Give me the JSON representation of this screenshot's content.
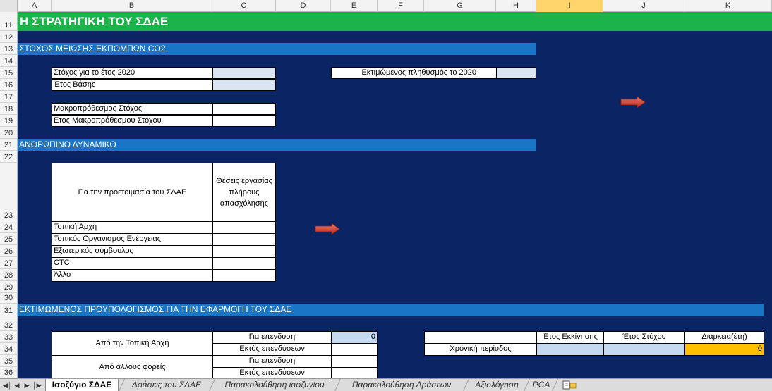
{
  "columns": [
    "A",
    "B",
    "C",
    "D",
    "E",
    "F",
    "G",
    "H",
    "I",
    "J",
    "K"
  ],
  "selected_column": "I",
  "rows": [
    "11",
    "12",
    "13",
    "14",
    "15",
    "16",
    "17",
    "18",
    "19",
    "20",
    "21",
    "22",
    "23",
    "24",
    "25",
    "26",
    "27",
    "28",
    "29",
    "30",
    "31",
    "32",
    "33",
    "34",
    "35",
    "36"
  ],
  "title": "Η ΣΤΡΑΤΗΓΙΚΗ ΤΟΥ ΣΔΑΕ",
  "section_co2": {
    "heading": "ΣΤΟΧΟΣ ΜΕΙΩΣΗΣ ΕΚΠΟΜΠΩΝ CO2",
    "target_2020": "Στόχος για το έτος 2020",
    "base_year": "Έτος Βάσης",
    "long_term_target": "Μακροπρόθεσμος Στόχος",
    "long_term_year": "Ετος Μακροπρόθεσμου Στόχου",
    "population_2020": "Εκτιμώμενος πληθυσμός το 2020"
  },
  "section_staff": {
    "heading": "ΑΝΘΡΩΠΙΝΟ ΔΥΝΑΜΙΚΟ",
    "header_left": "Για την προετοιμασία του ΣΔΑΕ",
    "header_right": "Θέσεις εργασίας πλήρους απασχόλησης",
    "rows": [
      "Τοπική Αρχή",
      "Τοπικός Οργανισμός Ενέργειας",
      "Εξωτερικός σύμβουλος",
      "CTC",
      "Άλλο"
    ]
  },
  "section_budget": {
    "heading": "ΕΚΤΙΜΩΜΕΝΟΣ ΠΡΟΥΠΟΛΟΓΙΣΜΟΣ ΓΙΑ ΤΗΝ ΕΦΑΡΜΟΓΗ ΤΟΥ ΣΔΑΕ",
    "local_authority": "Από την Τοπική Αρχή",
    "other_bodies": "Από άλλους φορείς",
    "investment": "Για επένδυση",
    "non_investment": "Εκτός επενδύσεων",
    "investment_value": "0",
    "period_label": "Χρονική περίοδος",
    "start_year": "Έτος Εκκίνησης",
    "target_year": "Έτος Στόχου",
    "duration": "Διάρκεια(έτη)",
    "duration_value": "0"
  },
  "sheet_tabs": [
    "Ισοζύγιο ΣΔΑΕ",
    "Δράσεις του ΣΔΑΕ",
    "Παρακολούθηση ισοζυγίου",
    "Παρακολούθηση Δράσεων",
    "Αξιολόγηση",
    "PCA"
  ],
  "active_tab": "Ισοζύγιο ΣΔΑΕ",
  "icons": {
    "tab_nav": [
      "first-sheet-icon",
      "prev-sheet-icon",
      "next-sheet-icon",
      "last-sheet-icon"
    ],
    "arrows": [
      "right-arrow-icon",
      "right-arrow-icon"
    ],
    "insert_sheet": "insert-sheet-icon"
  },
  "colors": {
    "sheet_bg": "#0b2463",
    "title_bar": "#1cb34a",
    "section_bar": "#1b75c6",
    "input_blue": "#dbe5f1",
    "duration_orange": "#ffc000",
    "arrow_red": "#d9463a"
  }
}
